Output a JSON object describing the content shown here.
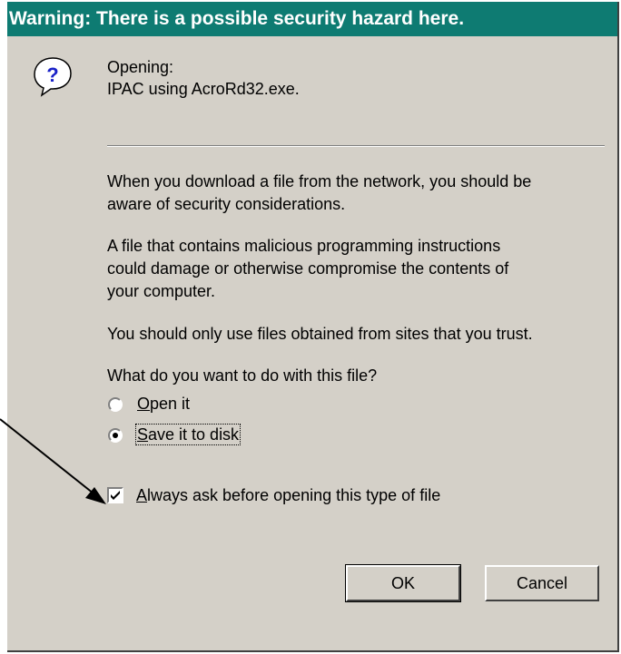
{
  "window": {
    "title": "Warning:  There is a possible security hazard here."
  },
  "file": {
    "opening_label": "Opening:",
    "name": "IPAC using AcroRd32.exe."
  },
  "message": {
    "para1_line1": "When you download a file from the network, you should be",
    "para1_line2": "aware of security considerations.",
    "para2_line1": "A file that contains malicious programming instructions",
    "para2_line2": "could damage or otherwise compromise the contents of",
    "para2_line3": "your computer.",
    "para3": "You should only use files obtained from sites that you trust."
  },
  "question": "What do you want to do with this file?",
  "options": {
    "open_key": "O",
    "open_rest": "pen it",
    "save_key": "S",
    "save_rest": "ave it to disk",
    "selected": "save"
  },
  "always_ask": {
    "key": "A",
    "rest": "lways ask before opening this type of file",
    "checked": true
  },
  "buttons": {
    "ok": "OK",
    "cancel": "Cancel"
  },
  "icons": {
    "question": "question-icon",
    "arrow": "annotation-arrow"
  },
  "colors": {
    "titlebar": "#0e7b72",
    "dialog": "#d4d0c8"
  }
}
